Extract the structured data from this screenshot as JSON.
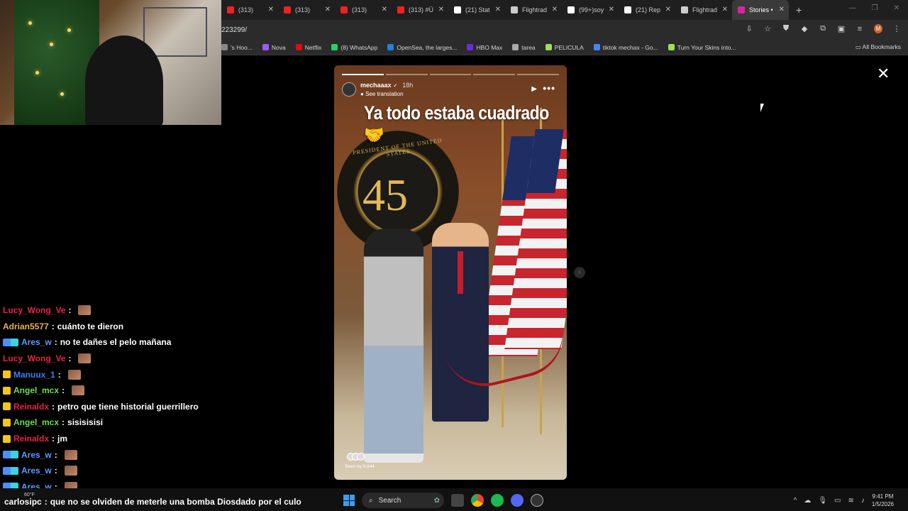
{
  "browser": {
    "tabs": [
      {
        "label": "(313)",
        "color": "#e22"
      },
      {
        "label": "(313)",
        "color": "#e22"
      },
      {
        "label": "(313)",
        "color": "#e22"
      },
      {
        "label": "(313) #Ü",
        "color": "#e22"
      },
      {
        "label": "(21) Stat",
        "color": "#fff"
      },
      {
        "label": "Flightrad",
        "color": "#ccc"
      },
      {
        "label": "(99+)soy",
        "color": "#fff"
      },
      {
        "label": "(21) Rep",
        "color": "#fff"
      },
      {
        "label": "Flightrad",
        "color": "#ccc"
      },
      {
        "label": "Stories •",
        "color": "#d6249f"
      }
    ],
    "new_tab": "+",
    "url": "223299/",
    "bookmarks": [
      {
        "label": "'s Hoo...",
        "color": "#888"
      },
      {
        "label": "Nova",
        "color": "#9b59ff"
      },
      {
        "label": "Netflix",
        "color": "#e50914"
      },
      {
        "label": "(8) WhatsApp",
        "color": "#25d366"
      },
      {
        "label": "OpenSea, the larges...",
        "color": "#2081e2"
      },
      {
        "label": "HBO Max",
        "color": "#6b2bd9"
      },
      {
        "label": "tarea",
        "color": "#aaa"
      },
      {
        "label": "PELICULA",
        "color": "#9be05a"
      },
      {
        "label": "tiktok mechax - Go...",
        "color": "#4285f4"
      },
      {
        "label": "Turn Your Skins into...",
        "color": "#9be05a"
      }
    ],
    "all_bookmarks": "All Bookmarks",
    "profile_initial": "M"
  },
  "story": {
    "username": "mechaaax",
    "verified": "✓",
    "time": "18h",
    "see_translation": "See translation",
    "caption": "Ya todo estaba cuadrado🤝",
    "seal_number": "45",
    "seal_text": "PRESIDENT OF THE UNITED STATES",
    "seen_by": "Seen by 8,644",
    "close": "✕",
    "next": "›"
  },
  "chat": [
    {
      "user": "Lucy_Wong_Ve",
      "color": "#e8214a",
      "badge": "",
      "text": "",
      "emote": true
    },
    {
      "user": "Adrian5577",
      "color": "#e8b24a",
      "badge": "",
      "text": "cuánto te dieron",
      "emote": false
    },
    {
      "user": "Ares_w",
      "color": "#5a9cff",
      "badge": "vip",
      "text": "no te dañes el pelo mañana",
      "emote": false
    },
    {
      "user": "Lucy_Wong_Ve",
      "color": "#e8214a",
      "badge": "",
      "text": "",
      "emote": true
    },
    {
      "user": "Manuux_1",
      "color": "#3c7ef0",
      "badge": "sub",
      "text": "",
      "emote": true
    },
    {
      "user": "Angel_mcx",
      "color": "#6be04a",
      "badge": "sub",
      "text": "",
      "emote": true
    },
    {
      "user": "Reinaldx",
      "color": "#e8214a",
      "badge": "sub",
      "text": "petro que tiene historial guerrillero",
      "emote": false
    },
    {
      "user": "Angel_mcx",
      "color": "#6be04a",
      "badge": "sub",
      "text": "sisisisisi",
      "emote": false
    },
    {
      "user": "Reinaldx",
      "color": "#e8214a",
      "badge": "sub",
      "text": "jm",
      "emote": false
    },
    {
      "user": "Ares_w",
      "color": "#5a9cff",
      "badge": "vip",
      "text": "",
      "emote": true
    },
    {
      "user": "Ares_w",
      "color": "#5a9cff",
      "badge": "vip",
      "text": "",
      "emote": true
    },
    {
      "user": "Ares_w",
      "color": "#5a9cff",
      "badge": "vip",
      "text": "",
      "emote": true
    }
  ],
  "last_message": {
    "user": "carlosipc",
    "text": "que no se olviden de meterle una bomba Diosdado por el culo"
  },
  "taskbar": {
    "weather": "60°F",
    "search": "Search",
    "time": "9:41 PM",
    "date": "1/5/2026"
  }
}
